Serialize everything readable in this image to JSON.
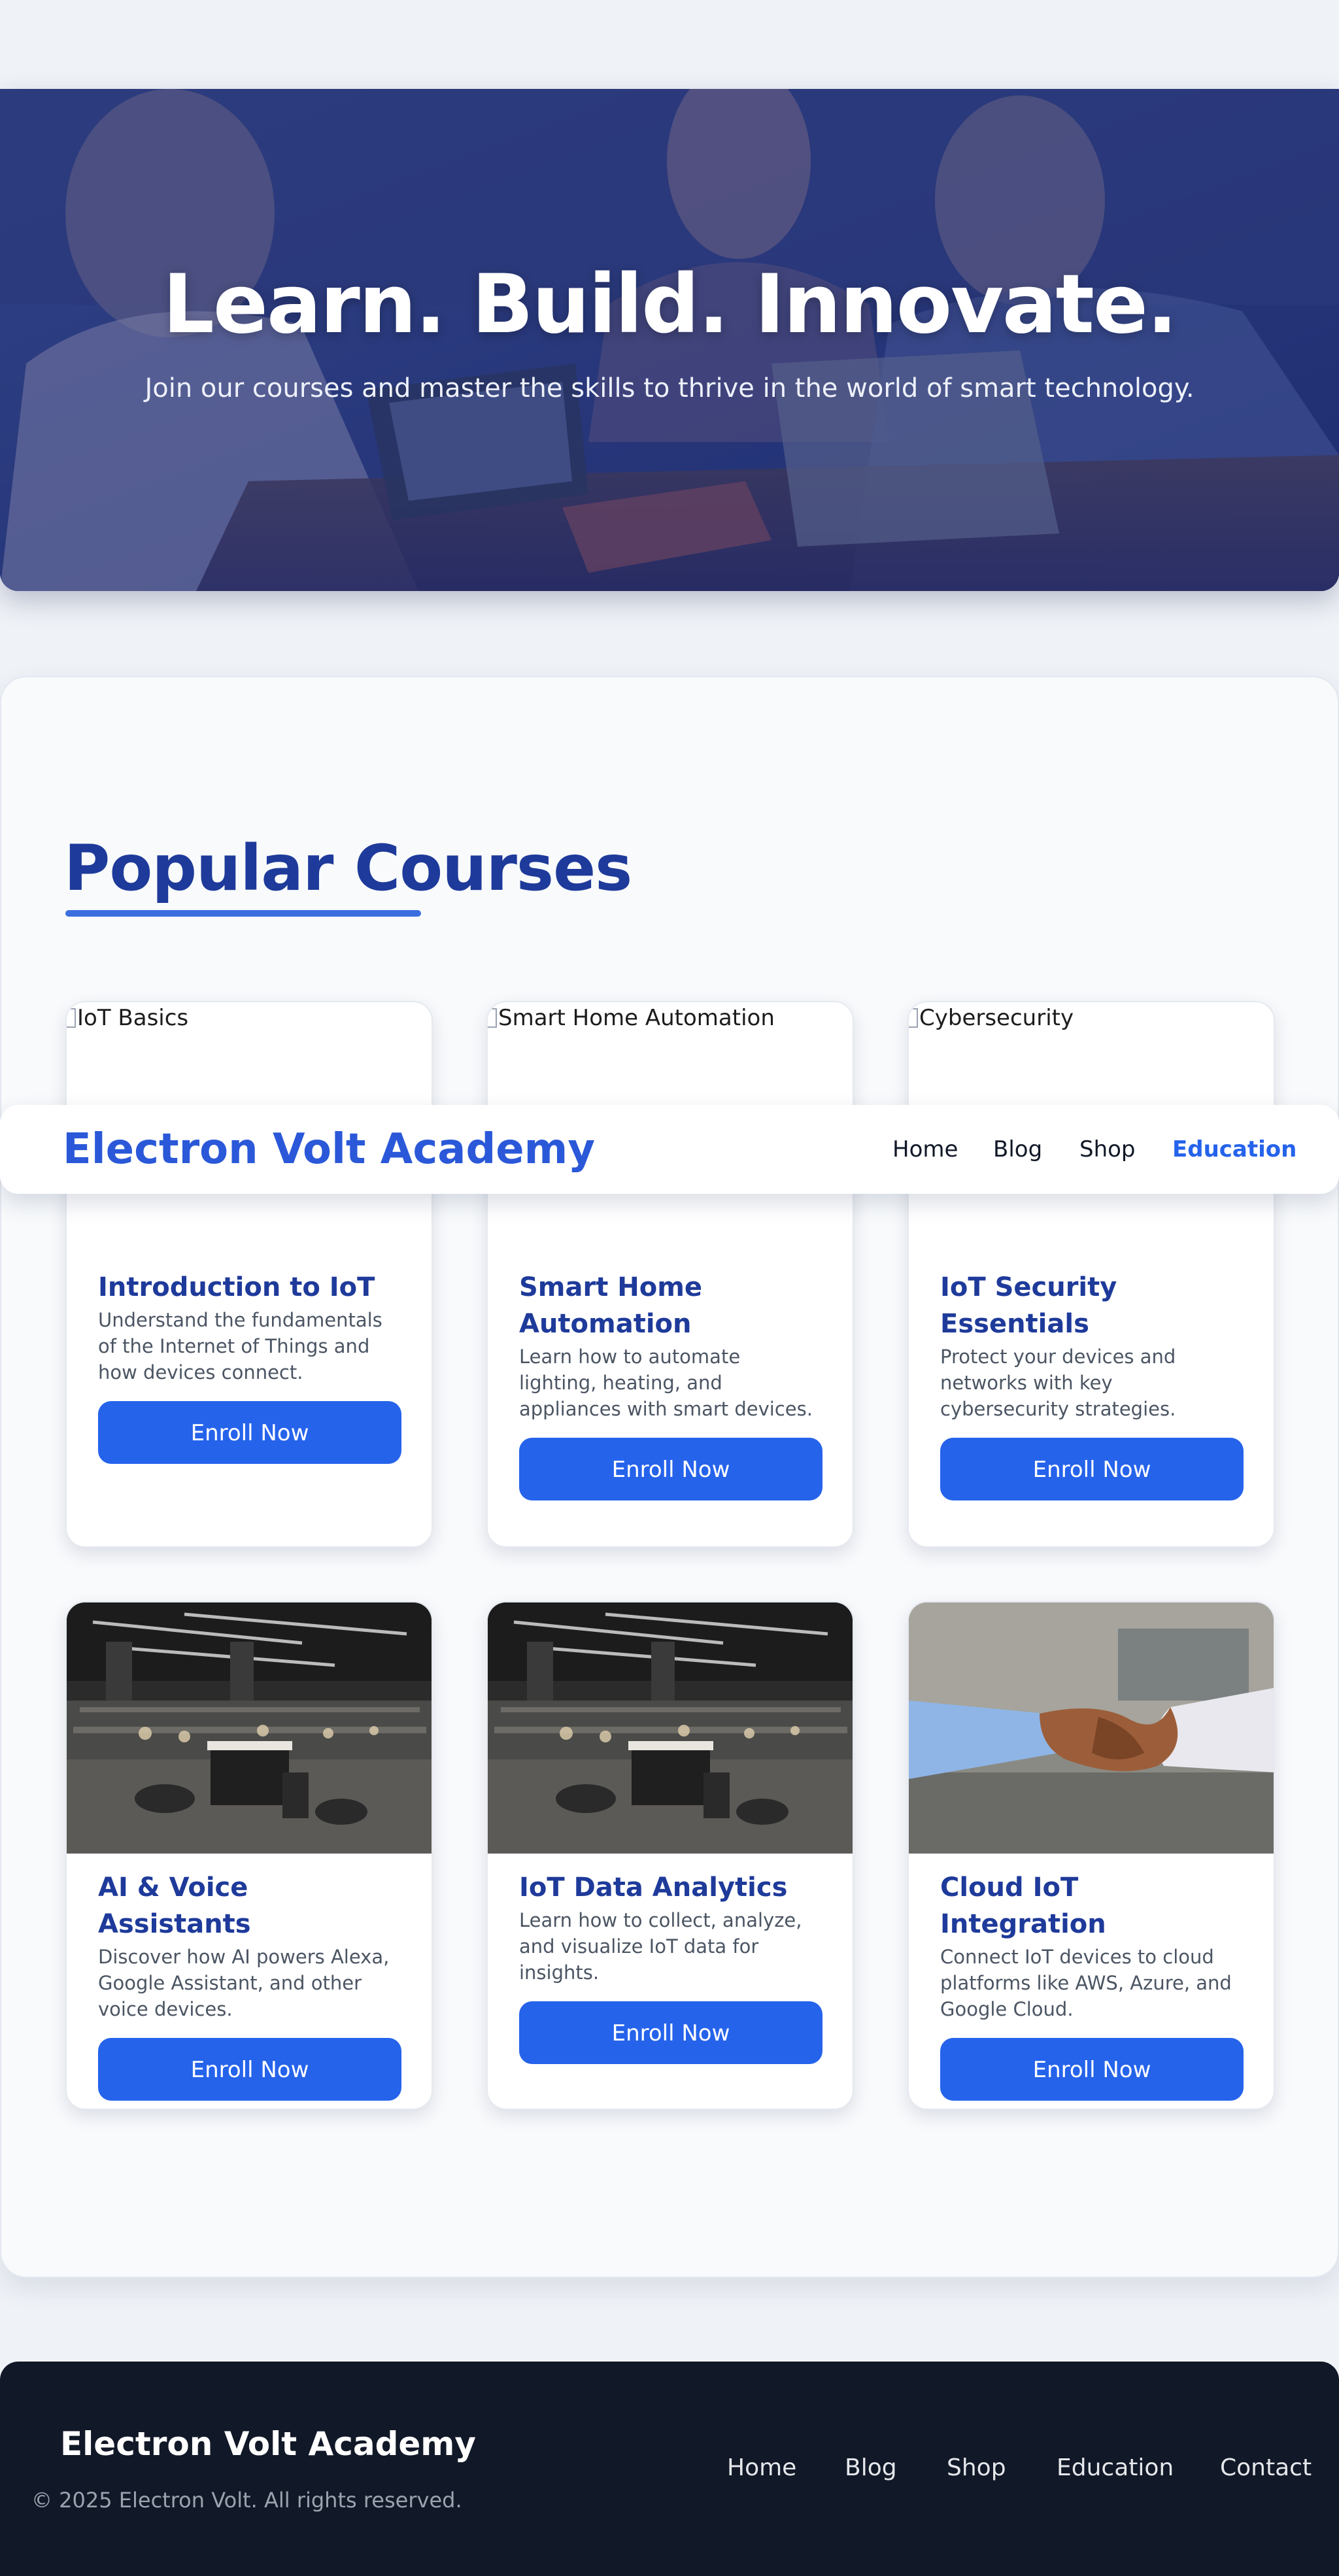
{
  "hero": {
    "title": "Learn. Build. Innovate.",
    "subtitle": "Join our courses and master the skills to thrive in the world of smart technology.",
    "overlay_color": "#233580"
  },
  "navbar": {
    "brand": "Electron Volt Academy",
    "links": [
      {
        "label": "Home",
        "active": false
      },
      {
        "label": "Blog",
        "active": false
      },
      {
        "label": "Shop",
        "active": false
      },
      {
        "label": "Education",
        "active": true
      }
    ]
  },
  "courses": {
    "heading": "Popular Courses",
    "items": [
      {
        "title": "Introduction to IoT",
        "description": "Understand the fundamentals of the Internet of Things and how devices connect.",
        "image_alt": "IoT Basics",
        "image_loaded": false,
        "button": "Enroll Now"
      },
      {
        "title": "Smart Home Automation",
        "description": "Learn how to automate lighting, heating, and appliances with smart devices.",
        "image_alt": "Smart Home Automation",
        "image_loaded": false,
        "button": "Enroll Now"
      },
      {
        "title": "IoT Security Essentials",
        "description": "Protect your devices and networks with key cybersecurity strategies.",
        "image_alt": "Cybersecurity",
        "image_loaded": false,
        "button": "Enroll Now"
      },
      {
        "title": "AI & Voice Assistants",
        "description": "Discover how AI powers Alexa, Google Assistant, and other voice devices.",
        "image_loaded": true,
        "image_subject": "office-workspace-photo",
        "button": "Enroll Now"
      },
      {
        "title": "IoT Data Analytics",
        "description": "Learn how to collect, analyze, and visualize IoT data for insights.",
        "image_loaded": true,
        "image_subject": "office-workspace-photo",
        "button": "Enroll Now"
      },
      {
        "title": "Cloud IoT Integration",
        "description": "Connect IoT devices to cloud platforms like AWS, Azure, and Google Cloud.",
        "image_loaded": true,
        "image_subject": "handshake-photo",
        "button": "Enroll Now"
      }
    ]
  },
  "footer": {
    "brand": "Electron Volt Academy",
    "copyright": "© 2025 Electron Volt. All rights reserved.",
    "links": [
      "Home",
      "Blog",
      "Shop",
      "Education",
      "Contact"
    ]
  },
  "colors": {
    "primary": "#2563eb",
    "heading": "#1e3a9a",
    "footer_bg": "#111827",
    "page_bg": "#eff2f7"
  }
}
